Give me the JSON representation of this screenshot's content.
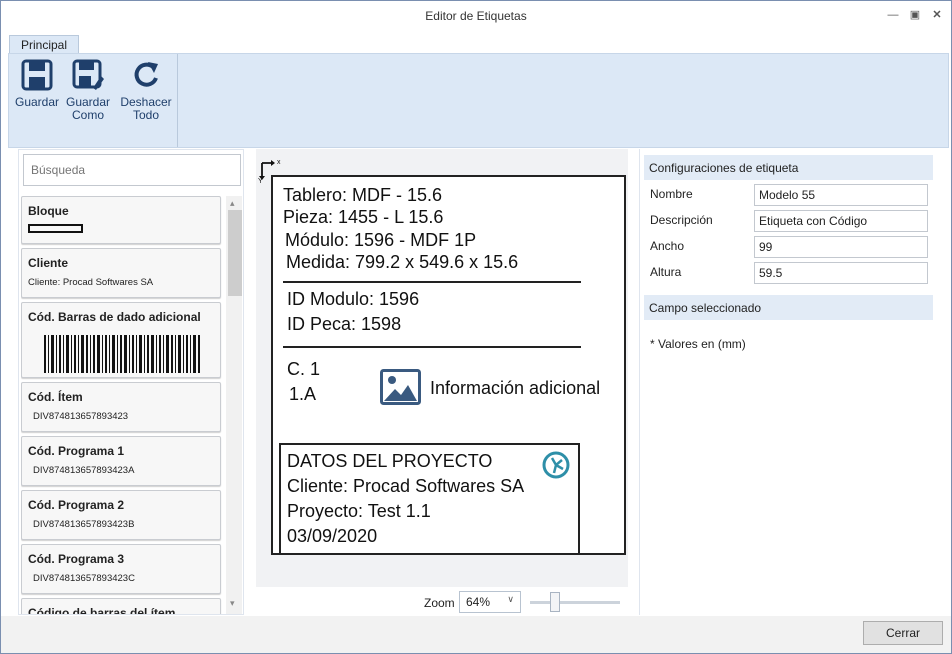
{
  "window": {
    "title": "Editor de Etiquetas"
  },
  "ribbon": {
    "tab": "Principal",
    "buttons": [
      {
        "line1": "Guardar",
        "line2": ""
      },
      {
        "line1": "Guardar",
        "line2": "Como"
      },
      {
        "line1": "Deshacer",
        "line2": "Todo"
      }
    ]
  },
  "fields_panel": {
    "search_placeholder": "Búsqueda",
    "items": [
      {
        "title": "Bloque",
        "value": ""
      },
      {
        "title": "Cliente",
        "value": "Cliente: Procad Softwares SA"
      },
      {
        "title": "Cód. Barras de dado adicional",
        "value": ""
      },
      {
        "title": "Cód. Ítem",
        "value": "DIV874813657893423"
      },
      {
        "title": "Cód. Programa 1",
        "value": "DIV874813657893423A"
      },
      {
        "title": "Cód. Programa 2",
        "value": "DIV874813657893423B"
      },
      {
        "title": "Cód. Programa 3",
        "value": "DIV874813657893423C"
      },
      {
        "title": "Código de barras del ítem",
        "value": ""
      }
    ]
  },
  "label": {
    "origin_x": "x",
    "origin_y": "Y",
    "lines1": [
      "Tablero: MDF - 15.6",
      "Pieza: 1455 - L 15.6",
      "Módulo: 1596 - MDF 1P",
      "Medida: 799.2 x 549.6 x 15.6"
    ],
    "lines2": [
      "ID Modulo: 1596",
      "ID Peca: 1598"
    ],
    "lines3": [
      "C. 1",
      "1.A"
    ],
    "image_text": "Información adicional",
    "project_lines": [
      "DATOS DEL PROYECTO",
      "Cliente: Procad Softwares SA",
      "Proyecto: Test 1.1",
      "03/09/2020"
    ]
  },
  "zoom": {
    "label": "Zoom",
    "value": "64%",
    "level_fraction": 0.25
  },
  "properties": {
    "section1": "Configuraciones de etiqueta",
    "rows": [
      {
        "label": "Nombre",
        "value": "Modelo 55"
      },
      {
        "label": "Descripción",
        "value": "Etiqueta con Código"
      },
      {
        "label": "Ancho",
        "value": "99"
      },
      {
        "label": "Altura",
        "value": "59.5"
      }
    ],
    "section2": "Campo seleccionado",
    "note": "* Valores en (mm)"
  },
  "footer": {
    "close_label": "Cerrar"
  },
  "icons": [
    "save-icon",
    "save-as-icon",
    "undo-all-icon",
    "image-icon",
    "logo-icon",
    "minimize-icon",
    "maximize-icon",
    "close-icon",
    "chevron-down-icon"
  ]
}
